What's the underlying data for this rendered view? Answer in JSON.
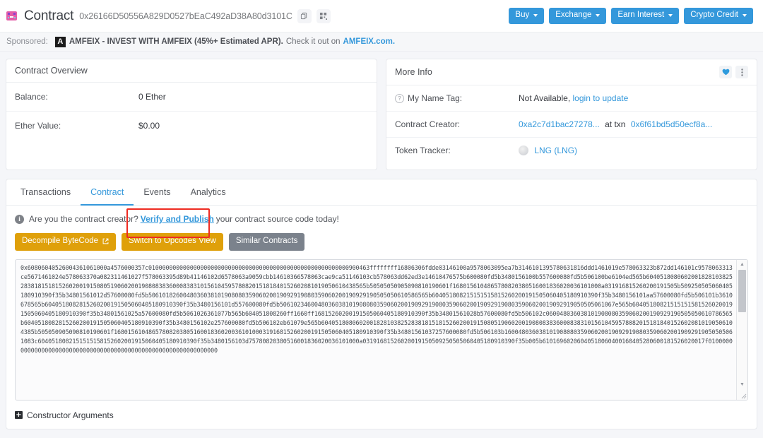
{
  "header": {
    "logo_name": "etherscan-logo-icon",
    "title": "Contract",
    "address": "0x26166D50556A829D0527bEaC492aD38A80d3101C",
    "copy_icon": "copy-icon",
    "qr_icon": "qr-code-icon",
    "buttons": [
      {
        "label": "Buy",
        "has_caret": true
      },
      {
        "label": "Exchange",
        "has_caret": true
      },
      {
        "label": "Earn Interest",
        "has_caret": true
      },
      {
        "label": "Crypto Credit",
        "has_caret": true
      }
    ],
    "accent_blue": "#3498db"
  },
  "sponsor": {
    "label": "Sponsored:",
    "logo_letter": "A",
    "strong_text": "AMFEIX - INVEST WITH AMFEIX (45%+ Estimated APR).",
    "rest_text": "Check it out on",
    "link_text": "AMFEIX.com."
  },
  "contract_overview": {
    "title": "Contract Overview",
    "rows": [
      {
        "label": "Balance:",
        "value": "0 Ether"
      },
      {
        "label": "Ether Value:",
        "value": "$0.00"
      }
    ]
  },
  "more_info": {
    "title": "More Info",
    "heart_icon": "heart-icon",
    "menu_icon": "kebab-menu-icon",
    "name_tag": {
      "label": "My Name Tag:",
      "value": "Not Available,",
      "link": "login to update"
    },
    "creator": {
      "label": "Contract Creator:",
      "address_link": "0xa2c7d1bac27278...",
      "middle_text": "at txn",
      "txn_link": "0x6f61bd5d50ecf8a..."
    },
    "token_tracker": {
      "label": "Token Tracker:",
      "link": "LNG (LNG)"
    }
  },
  "tabs": [
    {
      "label": "Transactions",
      "active": false
    },
    {
      "label": "Contract",
      "active": true
    },
    {
      "label": "Events",
      "active": false
    },
    {
      "label": "Analytics",
      "active": false
    }
  ],
  "notice": {
    "icon": "info-icon",
    "text_before": "Are you the contract creator?",
    "link": "Verify and Publish",
    "text_after": "your contract source code today!",
    "highlight_color": "#ee2b22"
  },
  "action_buttons": [
    {
      "label": "Decompile ByteCode",
      "style": "orange",
      "external_icon": true
    },
    {
      "label": "Switch to Opcodes View",
      "style": "orange",
      "external_icon": false
    },
    {
      "label": "Similar Contracts",
      "style": "grey",
      "external_icon": false
    }
  ],
  "bytecode": {
    "value": "0x60806040526004361061000a4576000357c0100000000000000000000000000000000000000000000000000000000900463ffffffff16806306fdde03146100a9578063095ea7b3146101395780631816ddd1461019e578063323b872dd146101c9578063313ce5671461024e578063370a082311461027f578063395d89b41146102d6578063a9059cbb14610366578063cae9ca51146103cb578063dd62ed3e14610476575b600080fd5b3480156100b557600080fd5b506100be6104ed565b60405180806020018281038252838181518152602001915080519060200190808383600083831015610459578082015181840152602081019050610438565b50505050905090810190601f1680156104865780820380516001836020036101000a031916815260200191505b509250505060405180910390f35b34801561012d57600080fd5b506101826004803603810190808035906020019092919080359060200190929190505050610586565b604051808215151515815260200191505060405180910390f35b3480156101aa57600080fd5b506101b3610678565b6040518082815260200191505060405180910390f35b3480156101d557600080fd5b5061023460048036038101908080359060200190929190803590602001909291908035906020019092919050505061067e565b604051808215151515815260200191505060405180910390f35b34801561025a57600080fd5b5061026361077b565b604051808260ff1660ff16815260200191505060405180910390f35b34801561028b57600080fd5b506102c060048036038101908080359060200190929190505050610786565b6040518082815260200191505060405180910390f35b3480156102e257600080fd5b506102eb61079e565b604051808060200182810382528381815181526020019150805190602001908083836000838310156104595780820151818401526020810190506104385b505050905090810190601f168015610486578082038051600183602003610100031916815260200191505060405180910390f35b34801561037257600080fd5b506103b1600480360381019080803590602001909291908035906020019092919050505061083c6040518082151515158152602001915060405180910390f35b3480156103d75780820380516001836020036101000a03191681526020019150509250505060405180910390f35b005b61016960206040518060400160405280600181526020017f0100000000000000000000000000000000000000000000000000000000000000",
    "scroll_up_icon": "scroll-up-arrow-icon",
    "scroll_down_icon": "scroll-down-arrow-icon",
    "resize_icon": "resize-grip-icon"
  },
  "constructor": {
    "icon": "expand-plus-icon",
    "label": "Constructor Arguments"
  }
}
